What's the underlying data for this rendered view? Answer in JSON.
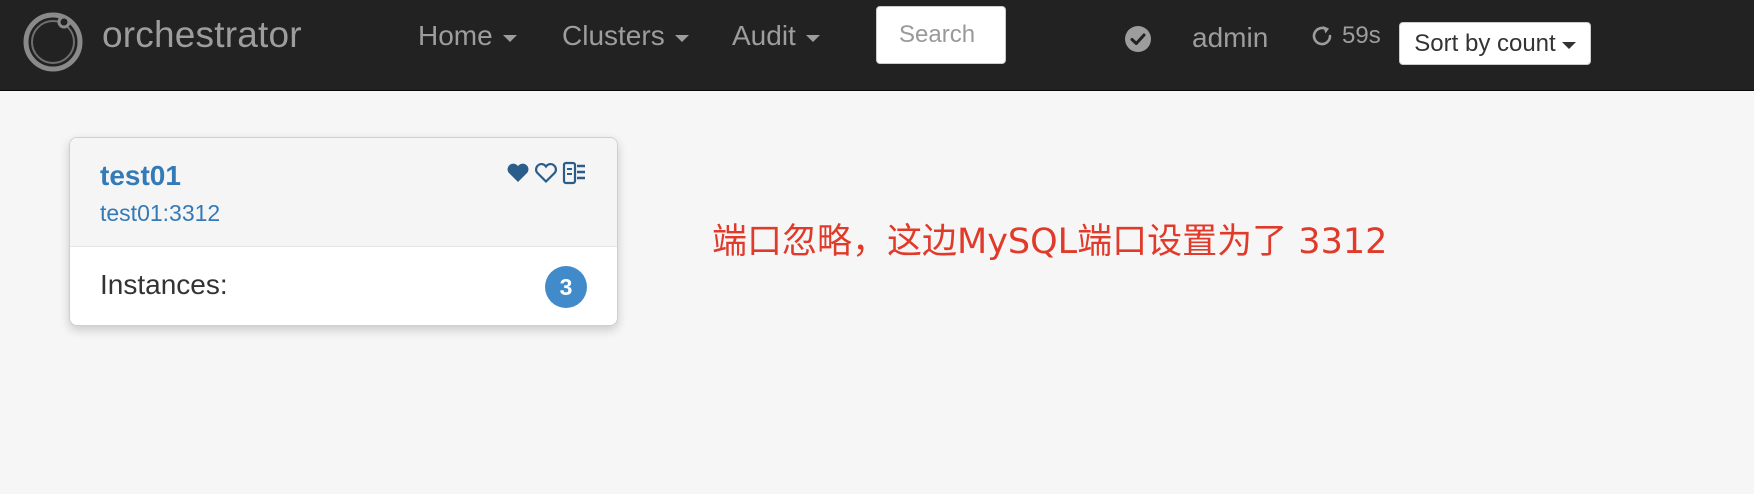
{
  "app": {
    "brand": "orchestrator"
  },
  "nav": {
    "home": "Home",
    "clusters": "Clusters",
    "audit": "Audit",
    "search_placeholder": "Search",
    "user": "admin",
    "refresh_countdown": "59s",
    "sort_label": "Sort by count"
  },
  "cluster_card": {
    "name": "test01",
    "alias": "test01:3312",
    "instances_label": "Instances:",
    "instances_count": "3",
    "icons": [
      "heart-filled-icon",
      "heart-outline-icon",
      "server-icon"
    ]
  },
  "annotation": "端口忽略，这边MySQL端口设置为了 3312",
  "colors": {
    "navbar": "#222222",
    "nav_text": "#9d9d9d",
    "link": "#337ab7",
    "badge": "#428bca",
    "annotation": "#e03a2a"
  }
}
